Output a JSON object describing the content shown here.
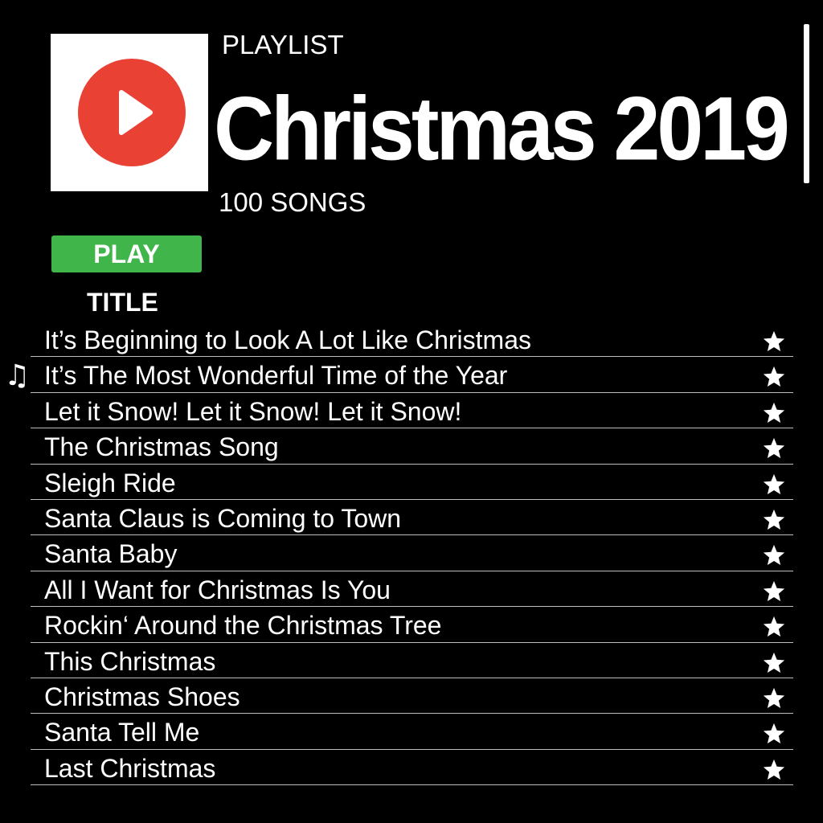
{
  "playlist": {
    "kicker": "PLAYLIST",
    "title": "Christmas 2019",
    "count": "100 SONGS",
    "cover_icon": "play-circle-icon"
  },
  "play_button": {
    "label": "PLAY",
    "color": "#3fb54a"
  },
  "columns": {
    "title": "TITLE"
  },
  "now_playing_icon": "music-note-icon",
  "now_playing_index": 1,
  "colors": {
    "background": "#000000",
    "text": "#ffffff",
    "accent_red": "#e94134",
    "play_green": "#3fb54a"
  },
  "tracks": [
    {
      "title": "It’s Beginning to Look A Lot Like Christmas",
      "starred": true
    },
    {
      "title": "It’s The Most Wonderful Time of the Year",
      "starred": true
    },
    {
      "title": "Let it Snow! Let it Snow! Let it Snow!",
      "starred": true
    },
    {
      "title": "The Christmas Song",
      "starred": true
    },
    {
      "title": "Sleigh Ride",
      "starred": true
    },
    {
      "title": "Santa Claus is Coming to Town",
      "starred": true
    },
    {
      "title": "Santa Baby",
      "starred": true
    },
    {
      "title": "All I Want for Christmas Is You",
      "starred": true
    },
    {
      "title": "Rockin‘ Around the Christmas Tree",
      "starred": true
    },
    {
      "title": "This Christmas",
      "starred": true
    },
    {
      "title": "Christmas Shoes",
      "starred": true
    },
    {
      "title": "Santa Tell Me",
      "starred": true
    },
    {
      "title": "Last Christmas",
      "starred": true
    }
  ]
}
